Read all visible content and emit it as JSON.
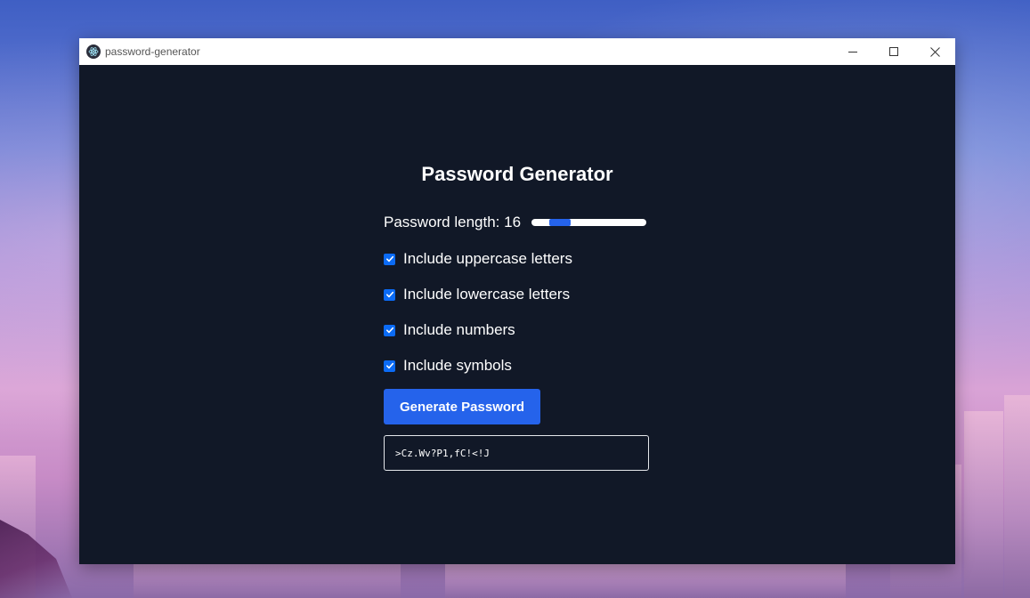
{
  "window": {
    "title": "password-generator"
  },
  "app": {
    "heading": "Password Generator",
    "length_label": "Password length: 16",
    "length_value": 16,
    "length_slider_fraction": 0.19,
    "options": [
      {
        "label": "Include uppercase letters",
        "checked": true
      },
      {
        "label": "Include lowercase letters",
        "checked": true
      },
      {
        "label": "Include numbers",
        "checked": true
      },
      {
        "label": "Include symbols",
        "checked": true
      }
    ],
    "generate_label": "Generate Password",
    "password": ">Cz.Wv?P1,fC!<!J"
  },
  "colors": {
    "background": "#111827",
    "accent": "#2563eb",
    "checkbox": "#0b6bf5",
    "text": "#ffffff"
  },
  "icons": {
    "app": "electron-atom-icon",
    "minimize": "minimize-icon",
    "maximize": "maximize-icon",
    "close": "close-icon",
    "check": "checkmark-icon"
  }
}
